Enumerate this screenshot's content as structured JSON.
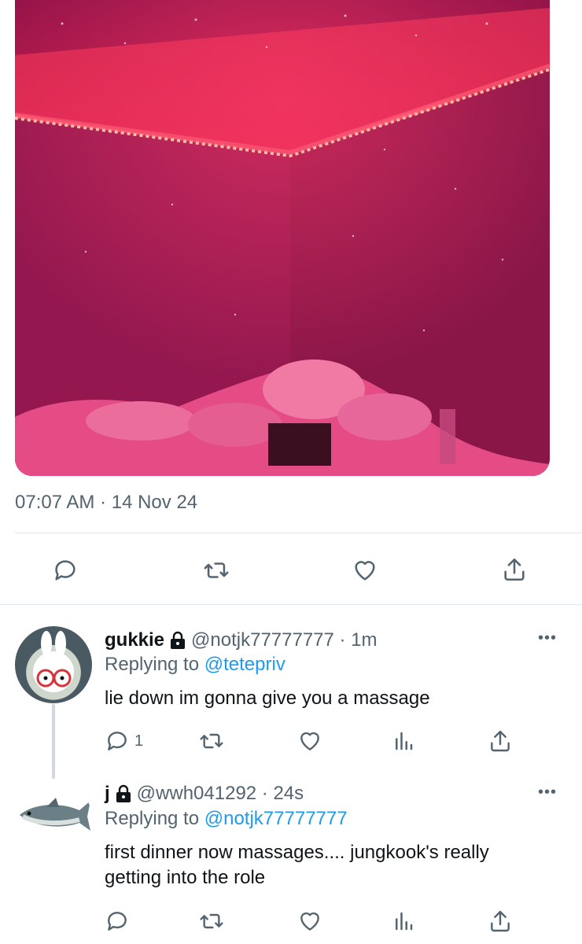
{
  "main_tweet": {
    "timestamp": "07:07 AM · 14 Nov 24"
  },
  "replies": [
    {
      "display_name": "gukkie",
      "handle_time": "@notjk77777777 · 1m",
      "replying_prefix": "Replying to",
      "replying_to": "@tetepriv",
      "text": "lie down im gonna give you a massage",
      "reply_count": "1"
    },
    {
      "display_name": "j",
      "handle_time": "@wwh041292 · 24s",
      "replying_prefix": "Replying to",
      "replying_to": "@notjk77777777",
      "text_line1": "first dinner now massages.... jungkook's really",
      "text_line2": "getting into the role"
    }
  ],
  "icons": {
    "reply": "reply-icon",
    "retweet": "retweet-icon",
    "like": "heart-icon",
    "analytics": "analytics-icon",
    "share": "share-icon",
    "more": "more-icon",
    "lock": "lock-icon"
  },
  "colors": {
    "text_primary": "#0f1419",
    "text_secondary": "#536471",
    "link": "#1d9bf0",
    "led_strip": "#ff5a72"
  },
  "more_glyph": "•••"
}
